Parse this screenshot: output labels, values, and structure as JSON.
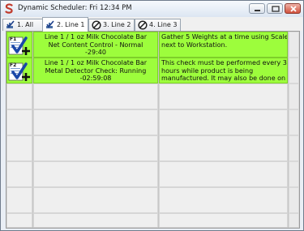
{
  "window": {
    "title": "Dynamic Scheduler: Fri 12:34 PM"
  },
  "controls": [
    "minimize-icon",
    "maximize-icon",
    "close-icon"
  ],
  "tabs": [
    {
      "label": "1. All",
      "icon": "scale-check-icon",
      "active": false
    },
    {
      "label": "2. Line 1",
      "icon": "scale-check-icon",
      "active": true
    },
    {
      "label": "3. Line 2",
      "icon": "no-entry-icon",
      "active": false
    },
    {
      "label": "4. Line 3",
      "icon": "no-entry-icon",
      "active": false
    }
  ],
  "rows": [
    {
      "key": "F1",
      "icon": "add-check-icon",
      "desc": [
        "Line 1 / 1 oz Milk Chocolate Bar",
        "Net Content Control - Normal",
        "-29:40"
      ],
      "note": [
        "Gather 5 Weights at a time using Scale",
        "next to Workstation."
      ]
    },
    {
      "key": "F2",
      "icon": "add-check-icon",
      "desc": [
        "Line 1 / 1 oz Milk Chocolate Bar",
        "Metal Detector Check: Running",
        "-02:59:08"
      ],
      "note": [
        "This check must be performed every 3",
        "hours while product is being",
        "manufactured. It may also be done on"
      ]
    }
  ],
  "colors": {
    "due_row": "#9dfd3c",
    "empty_row": "#efefef"
  }
}
